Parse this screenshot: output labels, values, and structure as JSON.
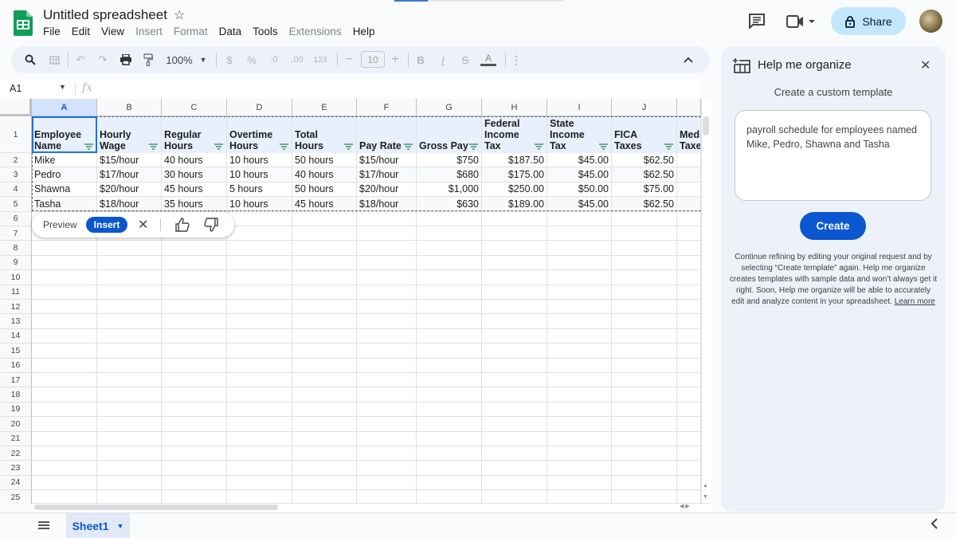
{
  "app": {
    "title": "Untitled spreadsheet",
    "menu": [
      {
        "label": "File",
        "enabled": true
      },
      {
        "label": "Edit",
        "enabled": true
      },
      {
        "label": "View",
        "enabled": true
      },
      {
        "label": "Insert",
        "enabled": false
      },
      {
        "label": "Format",
        "enabled": false
      },
      {
        "label": "Data",
        "enabled": true
      },
      {
        "label": "Tools",
        "enabled": true
      },
      {
        "label": "Extensions",
        "enabled": false
      },
      {
        "label": "Help",
        "enabled": true
      }
    ],
    "share_label": "Share"
  },
  "toolbar": {
    "zoom": "100%",
    "currency": "$",
    "percent": "%",
    "dec_decrease": ".0",
    "dec_increase": ".00",
    "number_format": "123",
    "font_size": "10",
    "bold": "B",
    "italic": "I",
    "text_color": "A"
  },
  "formula_bar": {
    "cell_ref": "A1",
    "fx": "fx",
    "value": ""
  },
  "sheet": {
    "columns": [
      "A",
      "B",
      "C",
      "D",
      "E",
      "F",
      "G",
      "H",
      "I",
      "J",
      ""
    ],
    "row_numbers": [
      "1",
      "2",
      "3",
      "4",
      "5",
      "6",
      "7",
      "8",
      "9",
      "10",
      "11",
      "12",
      "13",
      "14",
      "15",
      "16",
      "17",
      "18",
      "19",
      "20",
      "21",
      "22",
      "23",
      "24",
      "25"
    ],
    "header_row": [
      "Employee\nName",
      "Hourly\nWage",
      "Regular\nHours",
      "Overtime\nHours",
      "Total\nHours",
      "Pay Rate",
      "Gross Pay",
      "Federal\nIncome\nTax",
      "State\nIncome\nTax",
      "FICA\nTaxes",
      "Medi\nTaxes"
    ],
    "rows": [
      [
        "Mike",
        "$15/hour",
        "40 hours",
        "10 hours",
        "50 hours",
        "$15/hour",
        "$750",
        "$187.50",
        "$45.00",
        "$62.50",
        ""
      ],
      [
        "Pedro",
        "$17/hour",
        "30 hours",
        "10 hours",
        "40 hours",
        "$17/hour",
        "$680",
        "$175.00",
        "$45.00",
        "$62.50",
        ""
      ],
      [
        "Shawna",
        "$20/hour",
        "45 hours",
        "5 hours",
        "50 hours",
        "$20/hour",
        "$1,000",
        "$250.00",
        "$50.00",
        "$75.00",
        ""
      ],
      [
        "Tasha",
        "$18/hour",
        "35 hours",
        "10 hours",
        "45 hours",
        "$18/hour",
        "$630",
        "$189.00",
        "$45.00",
        "$62.50",
        ""
      ]
    ],
    "tab_name": "Sheet1"
  },
  "preview_popup": {
    "preview_label": "Preview",
    "insert_label": "Insert"
  },
  "panel": {
    "title": "Help me organize",
    "subtitle": "Create a custom template",
    "prompt_value": "payroll schedule for employees named Mike, Pedro, Shawna and Tasha",
    "create_label": "Create",
    "note": "Continue refining by editing your original request and by selecting “Create template” again. Help me organize creates templates with sample data and won’t always get it right. Soon, Help me organize will be able to accurately edit and analyze content in your spreadsheet.",
    "learn_more": "Learn more"
  },
  "colors": {
    "accent": "#0b57d0",
    "share_bg": "#c2e7ff",
    "panel_bg": "#edf2fa",
    "header_fill": "#e8f0fe",
    "selection": "#1a73e8"
  }
}
